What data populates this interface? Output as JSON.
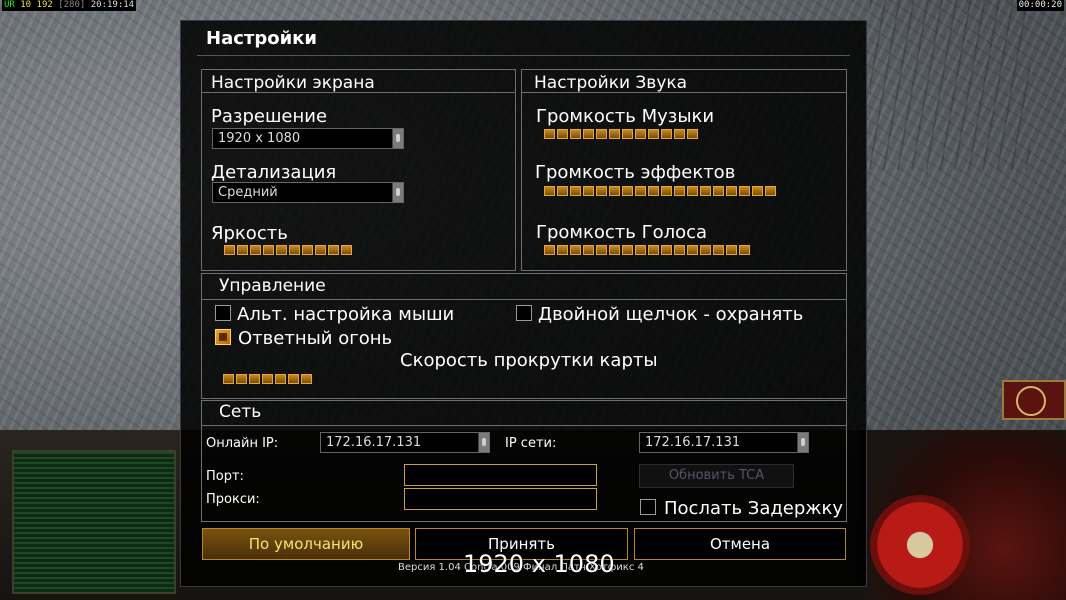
{
  "status_bar": {
    "left_parts": [
      "UR",
      "10",
      "192",
      "[280]",
      "20:19:14"
    ],
    "right_time": "00:00:20"
  },
  "dialog": {
    "title": "Настройки",
    "screen": {
      "header": "Настройки экрана",
      "resolution_label": "Разрешение",
      "resolution_value": "1920 x 1080",
      "detail_label": "Детализация",
      "detail_value": "Средний",
      "brightness_label": "Яркость",
      "brightness_segments": 10
    },
    "sound": {
      "header": "Настройки Звука",
      "music_label": "Громкость Музыки",
      "music_segments": 12,
      "effects_label": "Громкость эффектов",
      "effects_segments": 18,
      "voice_label": "Громкость Голоса",
      "voice_segments": 16
    },
    "control": {
      "header": "Управление",
      "alt_mouse_label": "Альт. настройка мыши",
      "alt_mouse_checked": false,
      "double_click_label": "Двойной щелчок - охранять",
      "double_click_checked": false,
      "return_fire_label": "Ответный огонь",
      "return_fire_checked": true,
      "scroll_label": "Скорость прокрутки карты",
      "scroll_segments": 7
    },
    "network": {
      "header": "Сеть",
      "online_ip_label": "Онлайн IP:",
      "online_ip_value": "172.16.17.131",
      "network_ip_label": "IP сети:",
      "network_ip_value": "172.16.17.131",
      "port_label": "Порт:",
      "port_value": "",
      "proxy_label": "Прокси:",
      "proxy_value": "",
      "update_tca_label": "Обновить TCA",
      "send_delay_label": "Послать Задержку",
      "send_delay_checked": false
    },
    "buttons": {
      "defaults": "По умолчанию",
      "accept": "Принять",
      "cancel": "Отмена"
    },
    "version_text": "Версия 1.04 Contra 009 Финал Патч Хотфикс 4",
    "overlay_resolution": "1920 x 1080"
  }
}
